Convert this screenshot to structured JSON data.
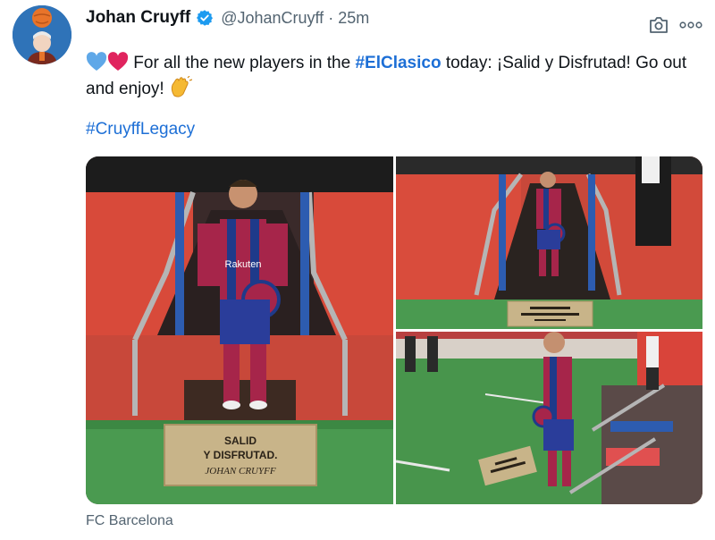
{
  "tweet": {
    "author_name": "Johan Cruyff",
    "handle": "@JohanCruyff",
    "separator": "·",
    "time": "25m",
    "text_before": "For all the new players in the ",
    "hashtag1": "#ElClasico",
    "text_after": " today: ¡Salid y Disfrutad! Go out and enjoy!",
    "hashtag2": "#CruyffLegacy",
    "source": "FC Barcelona"
  },
  "photos": {
    "mat_line1": "SALID",
    "mat_line2": "Y DISFRUTAD.",
    "mat_signature": "JOHAN CRUYFF",
    "shirt_sponsor": "Rakuten"
  },
  "colors": {
    "link": "#1d6fd6",
    "secondary": "#536471",
    "verified": "#1d9bf0",
    "heart_blue": "#5fa8e8",
    "heart_red": "#e0245e"
  }
}
